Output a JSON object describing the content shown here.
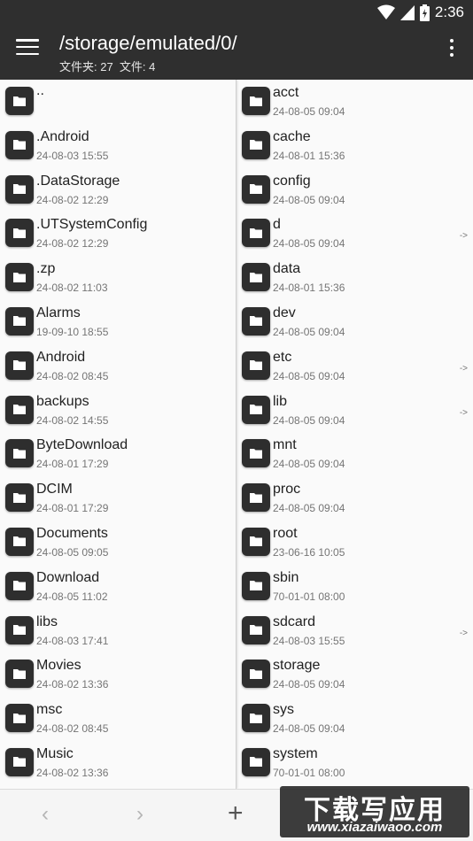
{
  "status_bar": {
    "time": "2:36",
    "icons": [
      "wifi-icon",
      "signal-icon",
      "battery-icon"
    ]
  },
  "app_bar": {
    "title": "/storage/emulated/0/",
    "subtitle": "文件夹: 27  文件: 4"
  },
  "left_pane": [
    {
      "name": "..",
      "date": ""
    },
    {
      "name": ".Android",
      "date": "24-08-03 15:55"
    },
    {
      "name": ".DataStorage",
      "date": "24-08-02 12:29"
    },
    {
      "name": ".UTSystemConfig",
      "date": "24-08-02 12:29"
    },
    {
      "name": ".zp",
      "date": "24-08-02 11:03"
    },
    {
      "name": "Alarms",
      "date": "19-09-10 18:55"
    },
    {
      "name": "Android",
      "date": "24-08-02 08:45"
    },
    {
      "name": "backups",
      "date": "24-08-02 14:55"
    },
    {
      "name": "ByteDownload",
      "date": "24-08-01 17:29"
    },
    {
      "name": "DCIM",
      "date": "24-08-01 17:29"
    },
    {
      "name": "Documents",
      "date": "24-08-05 09:05"
    },
    {
      "name": "Download",
      "date": "24-08-05 11:02"
    },
    {
      "name": "libs",
      "date": "24-08-03 17:41"
    },
    {
      "name": "Movies",
      "date": "24-08-02 13:36"
    },
    {
      "name": "msc",
      "date": "24-08-02 08:45"
    },
    {
      "name": "Music",
      "date": "24-08-02 13:36"
    }
  ],
  "right_pane": [
    {
      "name": "acct",
      "date": "24-08-05 09:04",
      "link": ""
    },
    {
      "name": "cache",
      "date": "24-08-01 15:36",
      "link": ""
    },
    {
      "name": "config",
      "date": "24-08-05 09:04",
      "link": ""
    },
    {
      "name": "d",
      "date": "24-08-05 09:04",
      "link": "->"
    },
    {
      "name": "data",
      "date": "24-08-01 15:36",
      "link": ""
    },
    {
      "name": "dev",
      "date": "24-08-05 09:04",
      "link": ""
    },
    {
      "name": "etc",
      "date": "24-08-05 09:04",
      "link": "->"
    },
    {
      "name": "lib",
      "date": "24-08-05 09:04",
      "link": "->"
    },
    {
      "name": "mnt",
      "date": "24-08-05 09:04",
      "link": ""
    },
    {
      "name": "proc",
      "date": "24-08-05 09:04",
      "link": ""
    },
    {
      "name": "root",
      "date": "23-06-16 10:05",
      "link": ""
    },
    {
      "name": "sbin",
      "date": "70-01-01 08:00",
      "link": ""
    },
    {
      "name": "sdcard",
      "date": "24-08-03 15:55",
      "link": "->"
    },
    {
      "name": "storage",
      "date": "24-08-05 09:04",
      "link": ""
    },
    {
      "name": "sys",
      "date": "24-08-05 09:04",
      "link": ""
    },
    {
      "name": "system",
      "date": "70-01-01 08:00",
      "link": ""
    }
  ],
  "bottom_bar": {
    "back": "‹",
    "forward": "›",
    "add": "+"
  },
  "watermark": {
    "title": "下载写应用",
    "url": "www.xiazaiwaoo.com"
  },
  "colors": {
    "appbar": "#2f2f2f",
    "folder_icon": "#2e2e2e",
    "name_text": "#212121",
    "date_text": "#757575"
  }
}
